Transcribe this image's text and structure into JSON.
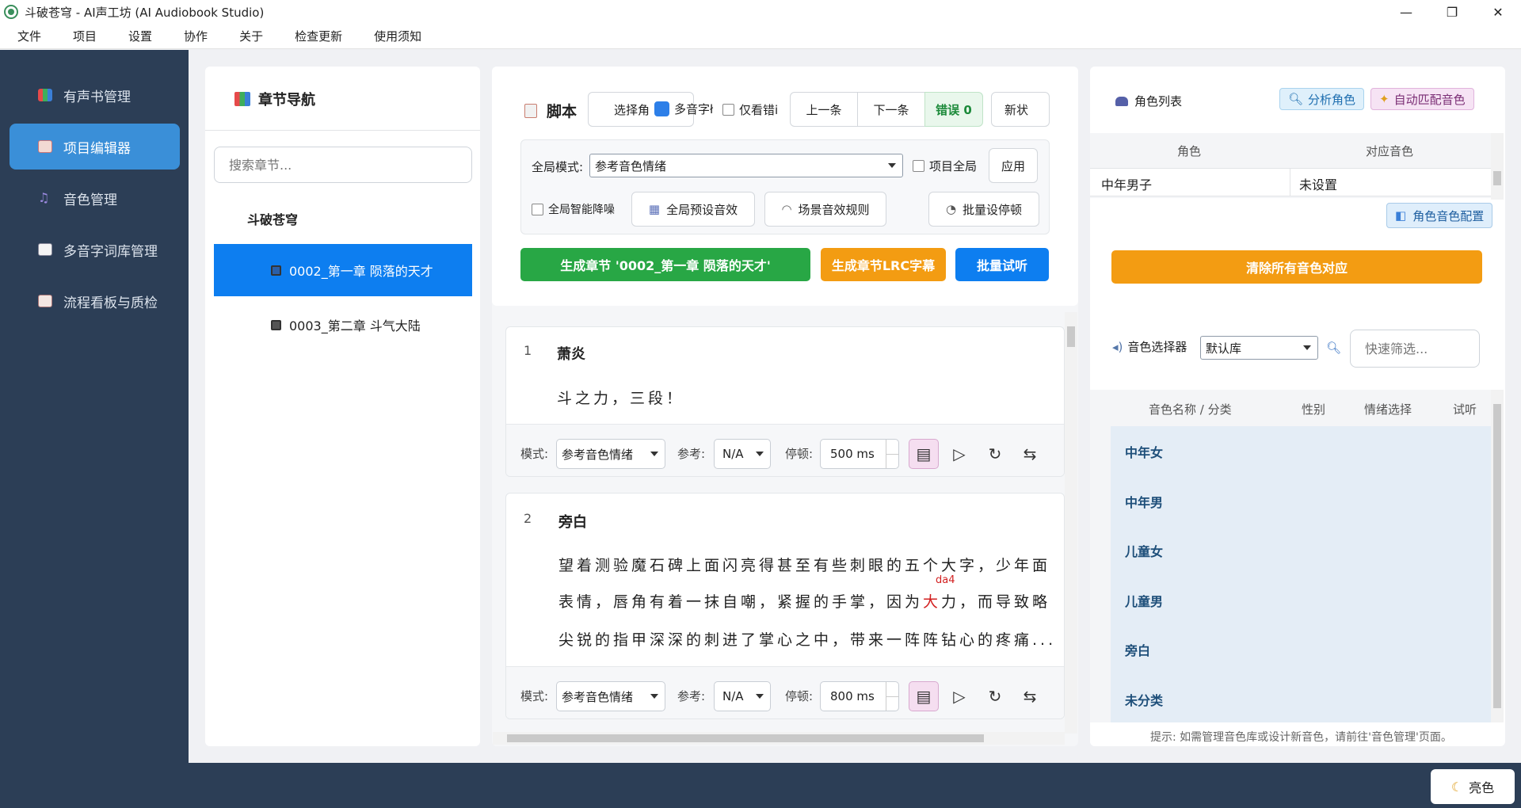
{
  "window": {
    "title": "斗破苍穹 - AI声工坊 (AI Audiobook Studio)",
    "minimize": "—",
    "maximize": "❐",
    "close": "✕"
  },
  "menu": [
    "文件",
    "项目",
    "设置",
    "协作",
    "关于",
    "检查更新",
    "使用须知"
  ],
  "sidebar": {
    "items": [
      {
        "label": "有声书管理",
        "icon": "books-icon"
      },
      {
        "label": "项目编辑器",
        "icon": "document-icon",
        "active": true
      },
      {
        "label": "音色管理",
        "icon": "music-note-icon"
      },
      {
        "label": "多音字词库管理",
        "icon": "dictionary-icon"
      },
      {
        "label": "流程看板与质检",
        "icon": "clipboard-icon"
      }
    ]
  },
  "chapter_nav": {
    "title": "章节导航",
    "search_placeholder": "搜索章节...",
    "book": "斗破苍穹",
    "chapters": [
      "0002_第一章 陨落的天才",
      "0003_第二章 斗气大陆"
    ]
  },
  "script": {
    "title": "脚本",
    "select_role_btn": "选择角",
    "polyphone_label": "多音字ł",
    "errors_only_label": "仅看错i",
    "prev_btn": "上一条",
    "next_btn": "下一条",
    "error_badge": "错误 0",
    "refresh_btn": "新状",
    "global_mode_label": "全局模式:",
    "global_mode_value": "参考音色情绪",
    "project_global_label": "项目全局",
    "apply_btn": "应用",
    "denoise_label": "全局智能降噪",
    "preset_fx_btn": "全局预设音效",
    "scene_fx_btn": "场景音效规则",
    "batch_pause_btn": "批量设停顿",
    "gen_chapter_btn": "生成章节 '0002_第一章 陨落的天才'",
    "gen_lrc_btn": "生成章节LRC字幕",
    "batch_preview_btn": "批量试听"
  },
  "lines": [
    {
      "num": "1",
      "speaker": "萧炎",
      "text": [
        "斗之力，三段！"
      ],
      "mode_label": "模式:",
      "mode": "参考音色情绪",
      "ref_label": "参考:",
      "ref": "N/A",
      "pause_label": "停顿:",
      "pause": "500 ms"
    },
    {
      "num": "2",
      "speaker": "旁白",
      "text_line1": "望着测验魔石碑上面闪亮得甚至有些刺眼的五个大字，少年面",
      "text_line2_a": "表情，唇角有着一抹自嘲，紧握的手掌，因为",
      "text_line2_mark": "大",
      "text_line2_b": "力，而导致略",
      "pinyin": "da4",
      "text_line3": "尖锐的指甲深深的刺进了掌心之中，带来一阵阵钻心的疼痛...",
      "mode_label": "模式:",
      "mode": "参考音色情绪",
      "ref_label": "参考:",
      "ref": "N/A",
      "pause_label": "停顿:",
      "pause": "800 ms"
    }
  ],
  "roles": {
    "title": "角色列表",
    "analyze_btn": "分析角色",
    "auto_match_btn": "自动匹配音色",
    "col_role": "角色",
    "col_voice": "对应音色",
    "rows": [
      {
        "role": "中年男子",
        "voice": "未设置"
      }
    ],
    "config_btn": "角色音色配置",
    "clear_btn": "清除所有音色对应"
  },
  "voice_selector": {
    "label": "音色选择器",
    "library": "默认库",
    "filter_placeholder": "快速筛选...",
    "col_name": "音色名称 / 分类",
    "col_gender": "性别",
    "col_emotion": "情绪选择",
    "col_preview": "试听",
    "categories": [
      "中年女",
      "中年男",
      "儿童女",
      "儿童男",
      "旁白",
      "未分类"
    ],
    "hint": "提示: 如需管理音色库或设计新音色，请前往'音色管理'页面。"
  },
  "theme_btn": "亮色",
  "colors": {
    "sidebar_bg": "#2c3e56",
    "active_blue": "#3a8fd8",
    "primary_blue": "#0d7ef0",
    "green": "#28a745",
    "orange": "#f39c12"
  }
}
